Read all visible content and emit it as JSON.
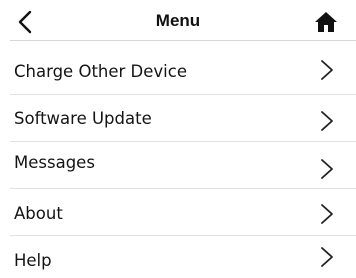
{
  "header": {
    "title": "Menu",
    "back_icon": "chevron-left-icon",
    "home_icon": "home-icon"
  },
  "menu": {
    "items": [
      {
        "label": "Charge Other Device",
        "icon": "chevron-right-icon"
      },
      {
        "label": "Software Update",
        "icon": "chevron-right-icon"
      },
      {
        "label": "Messages",
        "icon": "chevron-right-icon"
      },
      {
        "label": "About",
        "icon": "chevron-right-icon"
      },
      {
        "label": "Help",
        "icon": "chevron-right-icon"
      }
    ]
  },
  "colors": {
    "text": "#141414",
    "separator": "#e2e2e2",
    "background": "#ffffff"
  }
}
